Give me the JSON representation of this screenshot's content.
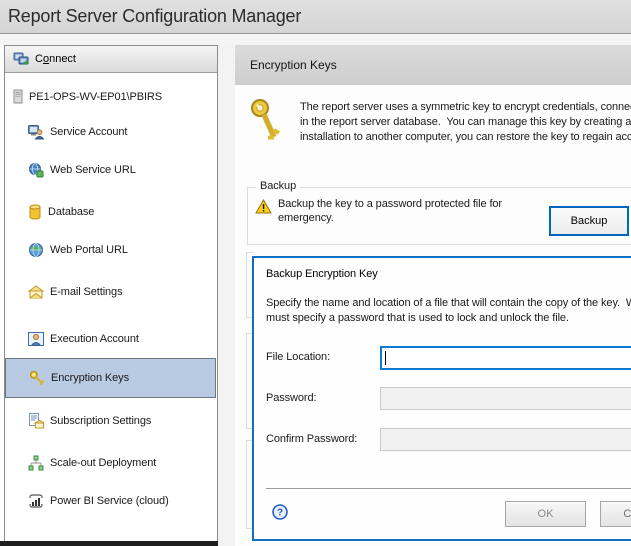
{
  "window": {
    "title": "Report Server Configuration Manager"
  },
  "colors": {
    "accent_blue": "#0f70c2",
    "focus_input_blue": "#0c7cd3",
    "selection_blue": "#b9cbe3",
    "warning_yellow": "#ffd117",
    "key_gold": "#eec93f"
  },
  "sidebar": {
    "connect": {
      "pre": "C",
      "mnemonic": "o",
      "post": "nnect"
    },
    "server": {
      "label": "PE1-OPS-WV-EP01\\PBIRS"
    },
    "items": [
      {
        "label": "Service Account"
      },
      {
        "label": "Web Service URL"
      },
      {
        "label": "Database"
      },
      {
        "label": "Web Portal URL"
      },
      {
        "label": "E-mail Settings"
      },
      {
        "label": "Execution Account"
      },
      {
        "label": "Encryption Keys",
        "selected": true
      },
      {
        "label": "Subscription Settings"
      },
      {
        "label": "Scale-out Deployment"
      },
      {
        "label": "Power BI Service (cloud)"
      }
    ]
  },
  "main": {
    "header": "Encryption Keys",
    "description": {
      "line1": "The report server uses a symmetric key to encrypt credentials, connection strings, and other data that is stored",
      "line2": "in the report server database.  You can manage this key by creating a backup copy.  If you move the report server",
      "line3": "installation to another computer, you can restore the key to regain access to encrypted content."
    },
    "backup_group": {
      "legend": "Backup",
      "text_line1": "Backup the key to a password protected file for",
      "text_line2": "emergency.",
      "button_label": "Backup"
    }
  },
  "dialog": {
    "title": "Backup Encryption Key",
    "text_line1": "Specify the name and location of a file that will contain the copy of the key.  When you backup the key, you",
    "text_line2": "must specify a password that is used to lock and unlock the file.",
    "fields": {
      "file_location": {
        "label": "File Location:",
        "value": ""
      },
      "password": {
        "label": "Password:",
        "value": ""
      },
      "confirm_password": {
        "label": "Confirm Password:",
        "value": ""
      }
    },
    "help_glyph": "?",
    "buttons": {
      "ok": "OK",
      "cancel": "Cancel"
    }
  }
}
